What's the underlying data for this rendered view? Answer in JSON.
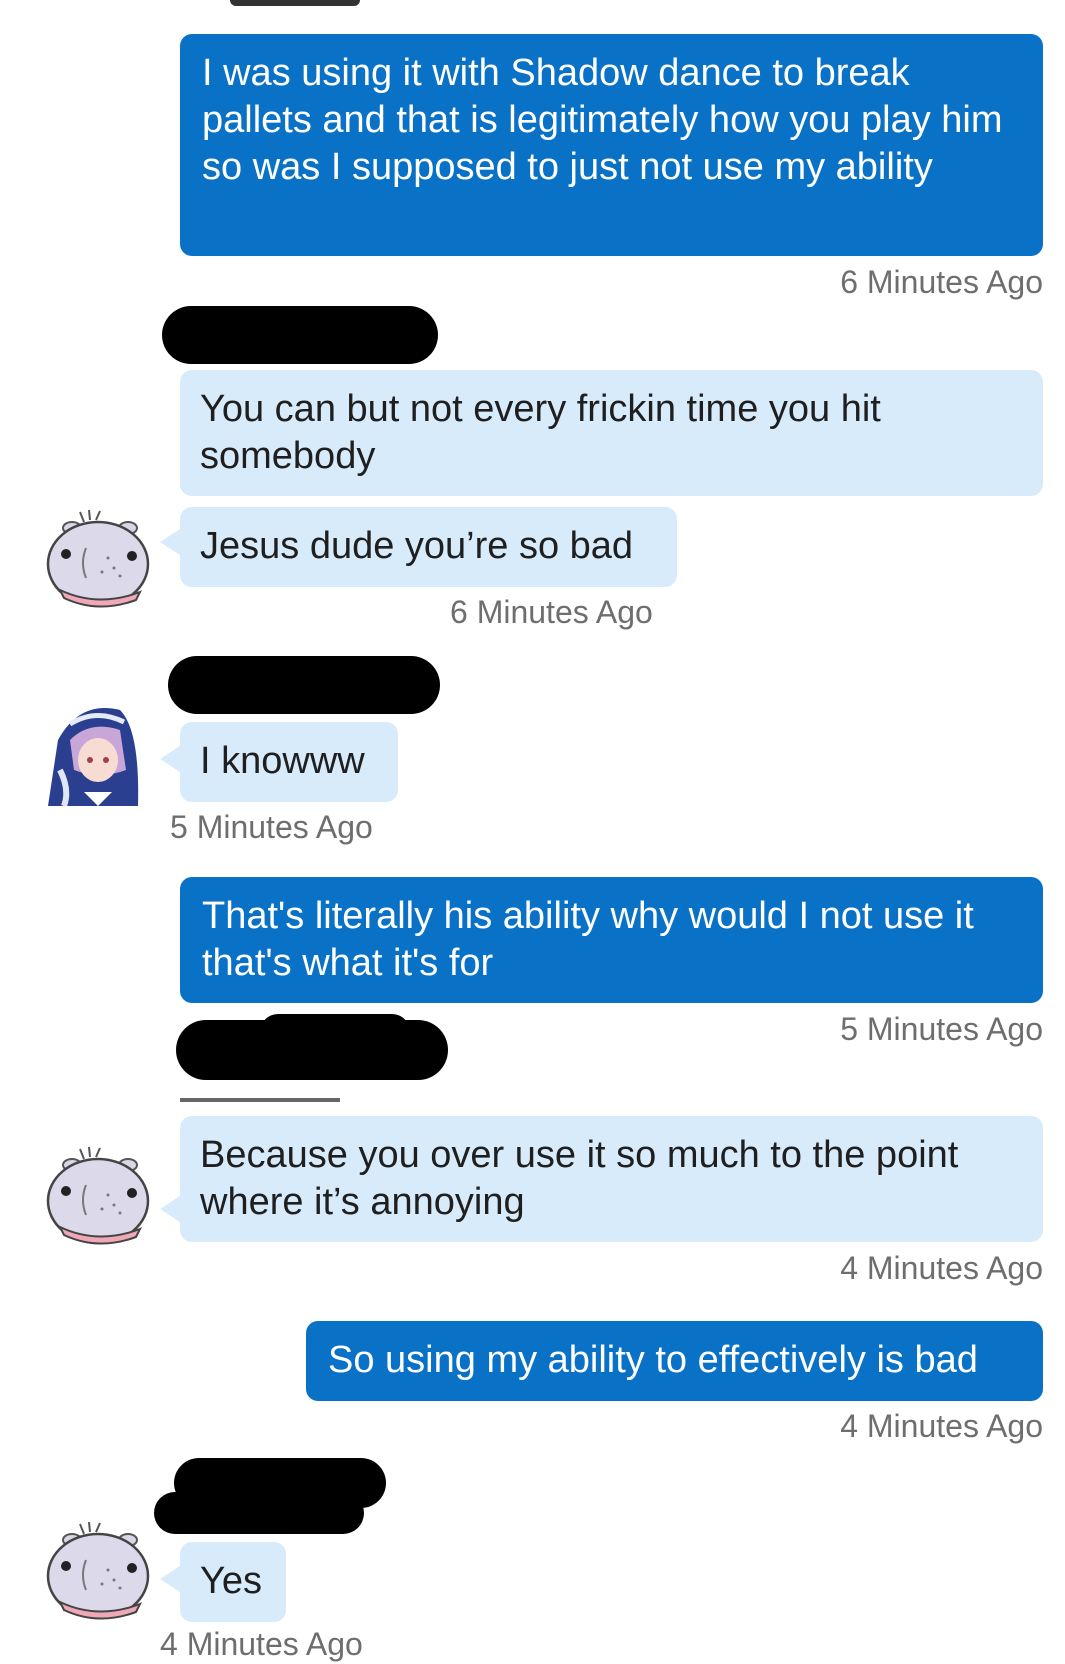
{
  "messages": [
    {
      "text": "I was using it with Shadow dance to break pallets and that is legitimately how you play him so was I supposed to just not use my ability",
      "time": "6 Minutes Ago"
    },
    {
      "text": "You can but not every frickin time you hit somebody"
    },
    {
      "text": "Jesus dude you’re so bad",
      "time": "6 Minutes Ago"
    },
    {
      "text": "I knowww",
      "time": "5 Minutes Ago"
    },
    {
      "text": "That's literally his ability why would I not use it that's what it's for",
      "time": "5 Minutes Ago"
    },
    {
      "text": "Because you over use it so much to the point where it’s annoying",
      "time": "4 Minutes Ago"
    },
    {
      "text": "So using my ability to effectively is bad",
      "time": "4 Minutes Ago"
    },
    {
      "text": "Yes",
      "time": "4 Minutes Ago"
    }
  ],
  "avatars": [
    "hippo-icon",
    "anime-nun-icon"
  ],
  "colors": {
    "outgoing_bubble": "#0a72c6",
    "incoming_bubble": "#d8ebfb",
    "timestamp": "#6e6e6e"
  }
}
